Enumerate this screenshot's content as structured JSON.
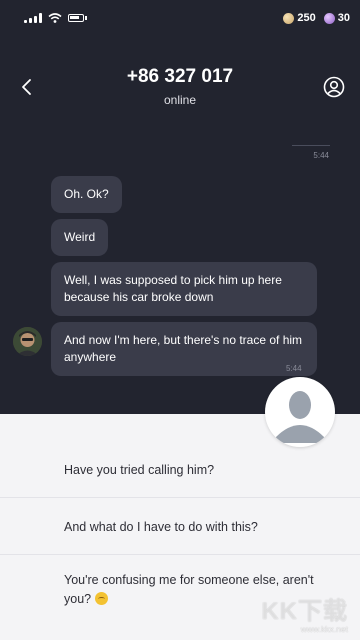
{
  "status_bar": {
    "coins": "250",
    "gems": "30"
  },
  "header": {
    "contact_name": "+86 327 017",
    "contact_status": "online"
  },
  "chat": {
    "sent_time": "5:44",
    "received_time": "5:44",
    "messages": [
      "Oh. Ok?",
      "Weird",
      "Well, I was supposed to pick him up here because his car broke down",
      "And now I'm here, but there's no trace of him anywhere"
    ]
  },
  "replies": [
    "Have you tried calling him?",
    "And what do I have to do with this?",
    "You're confusing me for someone else, aren't you?"
  ],
  "watermark": {
    "logo": "KK下载",
    "url": "www.kkx.net"
  },
  "icons": {
    "back": "back-arrow-icon",
    "profile": "user-circle-icon",
    "coin": "coin-icon",
    "gem": "gem-icon",
    "emoji": "upside-down-face-emoji"
  },
  "colors": {
    "chat_background": "#22242f",
    "bubble": "#3a3c4a",
    "reply_panel": "#f4f4f6"
  }
}
